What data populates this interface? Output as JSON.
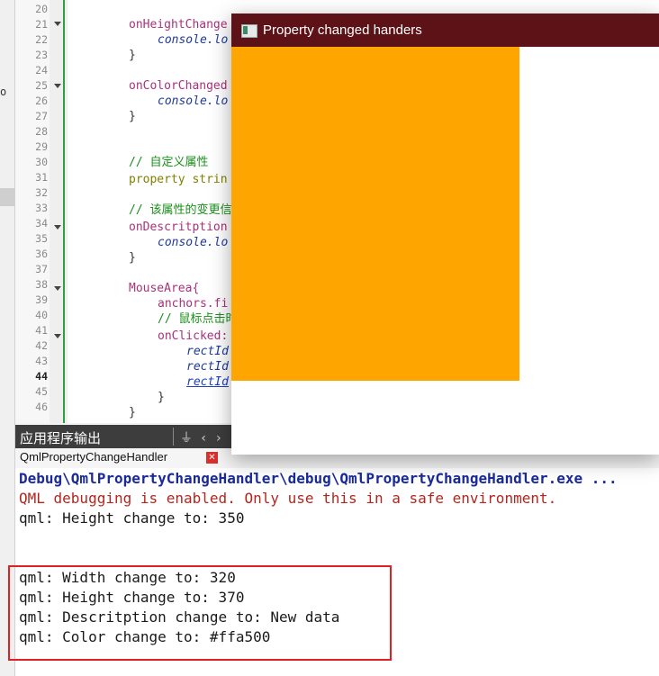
{
  "editor": {
    "line_numbers": [
      "20",
      "21",
      "22",
      "23",
      "24",
      "25",
      "26",
      "27",
      "28",
      "29",
      "30",
      "31",
      "32",
      "33",
      "34",
      "35",
      "36",
      "37",
      "38",
      "39",
      "40",
      "41",
      "42",
      "43",
      "44",
      "45",
      "46"
    ],
    "current_line": "44",
    "fold_lines": [
      "21",
      "25",
      "34",
      "38",
      "41"
    ],
    "lines": {
      "l21": "onHeightChange",
      "l22": "console.lo",
      "l23": "}",
      "l25": "onColorChanged",
      "l26": "console.lo",
      "l27": "}",
      "l30": "// 自定义属性",
      "l31_kw": "property",
      "l31_rest": " strin",
      "l33": "// 该属性的变更信",
      "l34": "onDescritption",
      "l35": "console.lo",
      "l36": "}",
      "l38": "MouseArea{",
      "l39": "anchors.fi",
      "l40": "// 鼠标点击时",
      "l41": "onClicked:",
      "l42": "rectId",
      "l43": "rectId",
      "l44": "rectId",
      "l45": "}",
      "l46": "}"
    }
  },
  "output_pane": {
    "title": "应用程序输出",
    "tab_label": "QmlPropertyChangeHandler",
    "lines": [
      "Debug\\QmlPropertyChangeHandler\\debug\\QmlPropertyChangeHandler.exe ...",
      "QML debugging is enabled. Only use this in a safe environment.",
      "qml: Height change to: 350",
      "",
      "",
      "qml: Width change to: 320",
      "qml: Height change to: 370",
      "qml: Descritption change to: New data",
      "qml: Color change to: #ffa500"
    ]
  },
  "window": {
    "title": "Property changed handers",
    "rect_color": "#ffa500",
    "titlebar_color": "#5c1217"
  },
  "left_strip": {
    "glyph": "o"
  },
  "icons": {
    "tab_close": "close-icon",
    "window": "window-icon",
    "tools": [
      "filter-icon",
      "chevron-left-icon",
      "chevron-right-icon"
    ]
  }
}
